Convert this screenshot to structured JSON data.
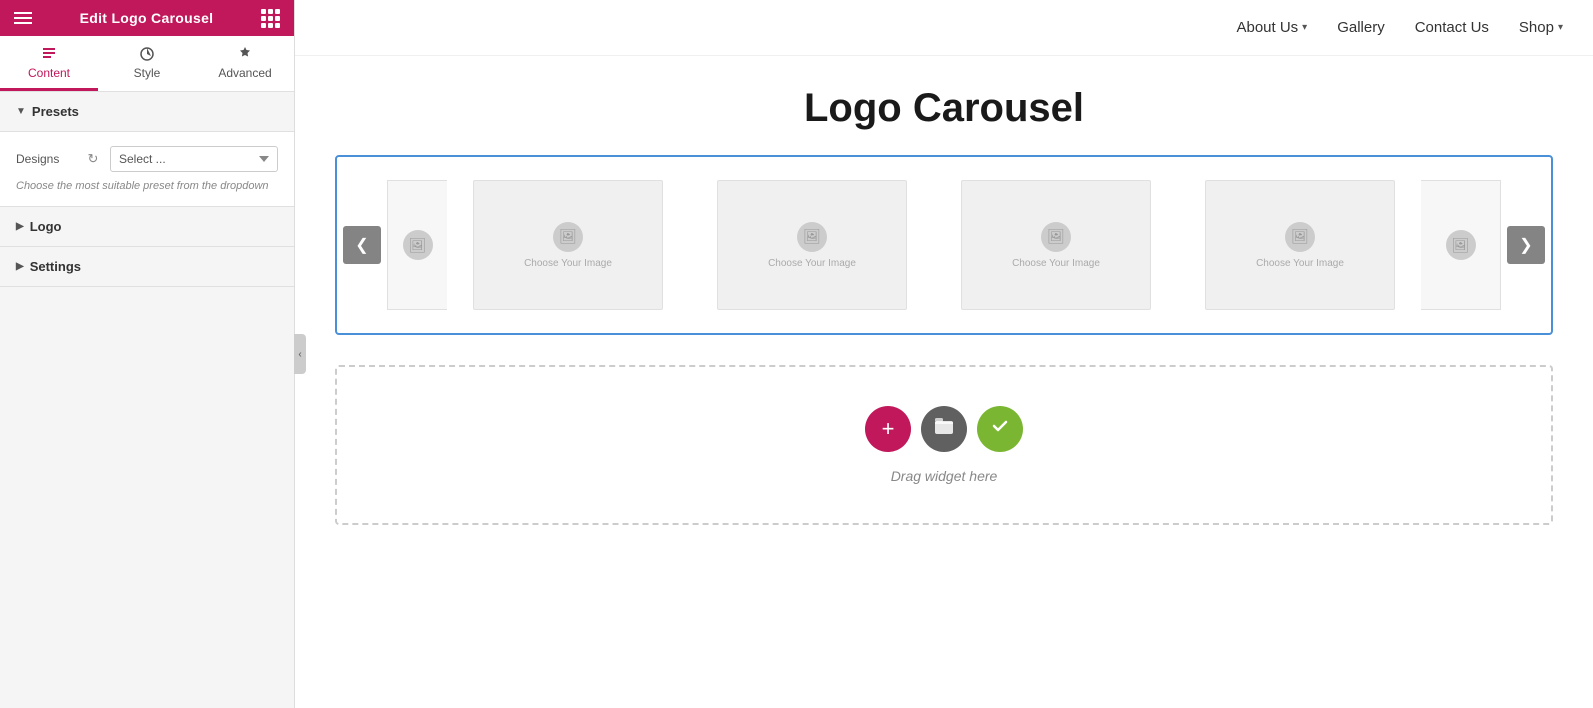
{
  "sidebar": {
    "header": {
      "title": "Edit Logo Carousel"
    },
    "tabs": [
      {
        "id": "content",
        "label": "Content",
        "active": true
      },
      {
        "id": "style",
        "label": "Style",
        "active": false
      },
      {
        "id": "advanced",
        "label": "Advanced",
        "active": false
      }
    ],
    "sections": [
      {
        "id": "presets",
        "label": "Presets",
        "expanded": true,
        "designs_label": "Designs",
        "select_placeholder": "Select ...",
        "hint": "Choose the most suitable preset from the dropdown"
      },
      {
        "id": "logo",
        "label": "Logo",
        "expanded": false
      },
      {
        "id": "settings",
        "label": "Settings",
        "expanded": false
      }
    ]
  },
  "topnav": {
    "items": [
      {
        "id": "about-us",
        "label": "About Us",
        "has_dropdown": true
      },
      {
        "id": "gallery",
        "label": "Gallery",
        "has_dropdown": false
      },
      {
        "id": "contact-us",
        "label": "Contact Us",
        "has_dropdown": false
      },
      {
        "id": "shop",
        "label": "Shop",
        "has_dropdown": true
      }
    ]
  },
  "main": {
    "carousel_title": "Logo Carousel",
    "carousel": {
      "arrow_left": "❮",
      "arrow_right": "❯",
      "slides": [
        {
          "id": "slide-1",
          "placeholder": "Choose Your Image"
        },
        {
          "id": "slide-2",
          "placeholder": "Choose Your Image"
        },
        {
          "id": "slide-3",
          "placeholder": "Choose Your Image"
        },
        {
          "id": "slide-4",
          "placeholder": "Choose Your Image"
        }
      ]
    },
    "drop_zone": {
      "drag_text": "Drag widget here",
      "btn_add": "+",
      "btn_folder": "▣",
      "btn_check": "✓"
    }
  },
  "colors": {
    "brand_pink": "#c0185a",
    "nav_blue": "#4a90d9",
    "btn_gray": "#606060",
    "btn_green": "#7ab632"
  }
}
